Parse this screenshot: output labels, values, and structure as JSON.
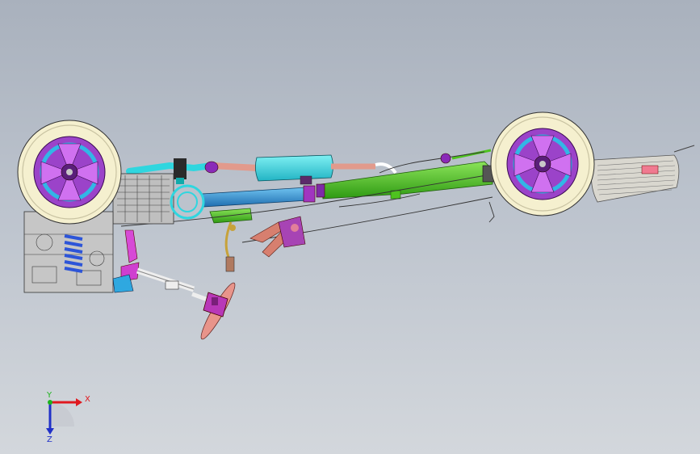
{
  "triad": {
    "x_label": "X",
    "y_label": "Y",
    "z_label": "Z",
    "x_color": "#e0191f",
    "y_color": "#1db31d",
    "z_color": "#2030c8"
  },
  "colors": {
    "background_top": "#a9b1bd",
    "background_bottom": "#d3d7dc",
    "tire": "#f5f0cf",
    "rim": "#9b43c9",
    "exhaust": "#2fd6df",
    "driveshaft": "#2f8fd6",
    "frame_rail": "#4ec21f",
    "steering": "#e06a6a",
    "spring": "#2d55d8"
  }
}
